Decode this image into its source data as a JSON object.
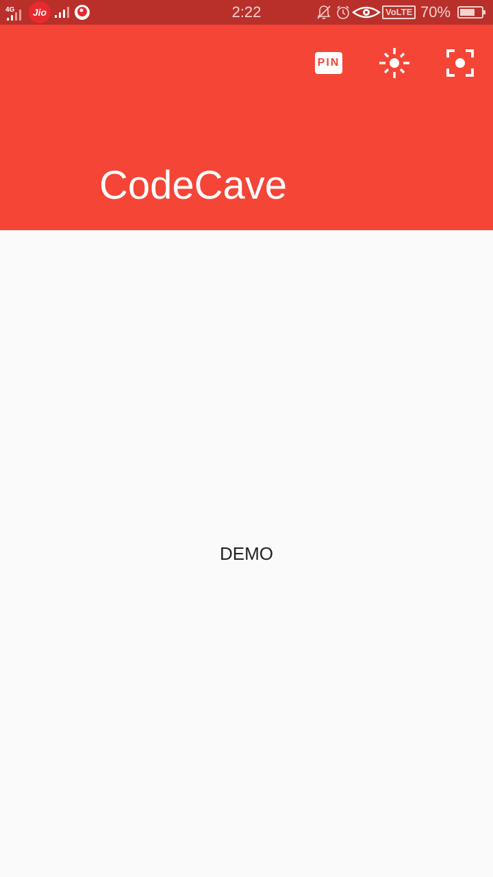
{
  "status_bar": {
    "network_type": "4G",
    "carrier_badge": "Jio",
    "time": "2:22",
    "volte": "VoLTE",
    "battery_percent": "70%",
    "battery_level": 0.7,
    "icons": [
      "signal-icon",
      "vodafone-icon",
      "mute-icon",
      "alarm-icon",
      "eye-icon",
      "battery-icon"
    ]
  },
  "app_bar": {
    "title": "CodeCave",
    "background_color": "#f44537",
    "actions": {
      "pin_label": "PIN",
      "brightness_icon": "brightness-icon",
      "screenshot_icon": "screenshot-focus-icon"
    }
  },
  "main": {
    "text": "DEMO"
  }
}
